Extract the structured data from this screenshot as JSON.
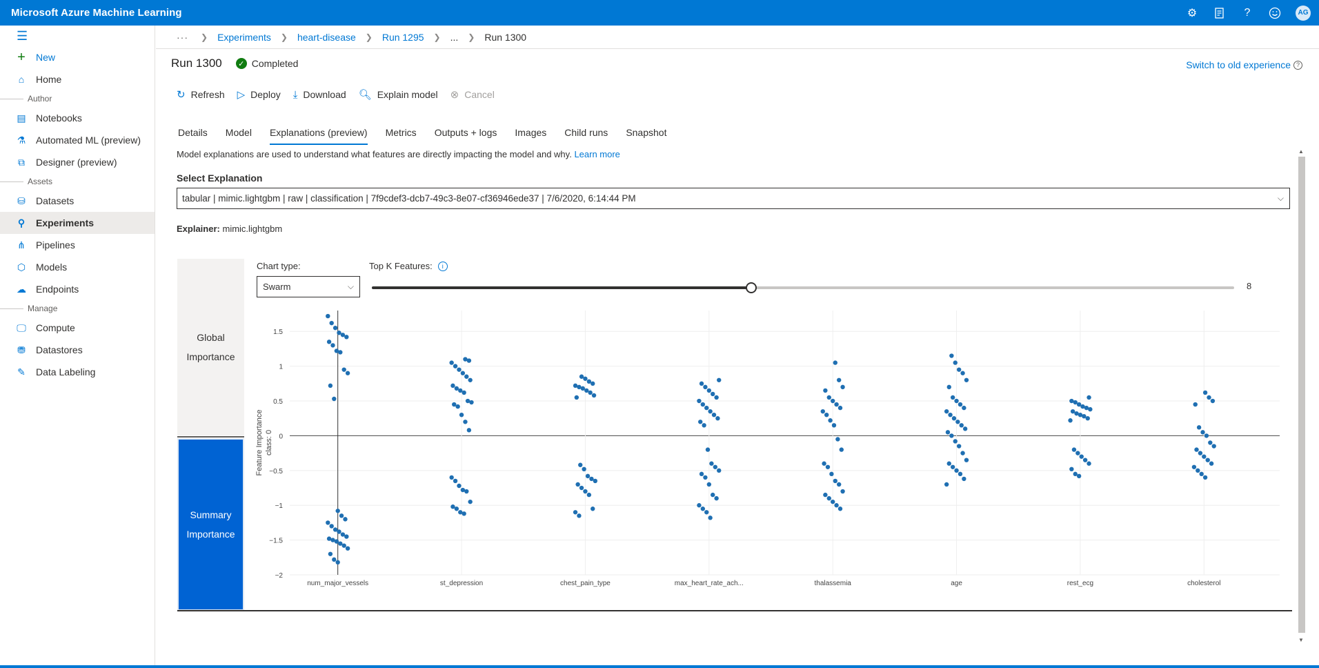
{
  "app": {
    "title": "Microsoft Azure Machine Learning",
    "avatar_initials": "AG",
    "top_icons": [
      "gear-icon",
      "feedback-icon",
      "help-icon",
      "smiley-icon"
    ]
  },
  "sidebar": {
    "new_label": "New",
    "home_label": "Home",
    "groups": {
      "author": "Author",
      "assets": "Assets",
      "manage": "Manage"
    },
    "author_items": [
      "Notebooks",
      "Automated ML (preview)",
      "Designer (preview)"
    ],
    "assets_items": [
      "Datasets",
      "Experiments",
      "Pipelines",
      "Models",
      "Endpoints"
    ],
    "manage_items": [
      "Compute",
      "Datastores",
      "Data Labeling"
    ],
    "active": "Experiments"
  },
  "breadcrumb": {
    "more": "···",
    "items": [
      "Experiments",
      "heart-disease",
      "Run 1295",
      "...",
      "Run 1300"
    ]
  },
  "run": {
    "title": "Run 1300",
    "status": "Completed",
    "switch_link": "Switch to old experience"
  },
  "toolbar": {
    "refresh": "Refresh",
    "deploy": "Deploy",
    "download": "Download",
    "explain": "Explain model",
    "cancel": "Cancel"
  },
  "tabs": [
    "Details",
    "Model",
    "Explanations (preview)",
    "Metrics",
    "Outputs + logs",
    "Images",
    "Child runs",
    "Snapshot"
  ],
  "active_tab": "Explanations (preview)",
  "explanations": {
    "description": "Model explanations are used to understand what features are directly impacting the model and why.",
    "learn_more": "Learn more",
    "select_label": "Select Explanation",
    "select_value": "tabular | mimic.lightgbm | raw | classification | 7f9cdef3-dcb7-49c3-8e07-cf36946ede37 | 7/6/2020, 6:14:44 PM",
    "explainer_label": "Explainer:",
    "explainer_value": "mimic.lightgbm"
  },
  "panel": {
    "global_tab": [
      "Global",
      "Importance"
    ],
    "summary_tab": [
      "Summary",
      "Importance"
    ],
    "chart_type_label": "Chart type:",
    "chart_type_value": "Swarm",
    "topk_label": "Top K Features:",
    "topk_value": "8",
    "topk_fraction": 0.44
  },
  "colors": {
    "accent": "#0078d4",
    "dot": "#1f6fb2",
    "success": "#107c10"
  },
  "chart_data": {
    "type": "scatter",
    "ylabel": "Feature Importance\nclass:  0",
    "ylim": [
      -2,
      1.8
    ],
    "yticks": [
      1.5,
      1,
      0.5,
      0,
      -0.5,
      -1,
      -1.5,
      -2
    ],
    "ytick_labels": [
      "1.5",
      "1",
      "0.5",
      "0",
      "−0.5",
      "−1",
      "−1.5",
      "−2"
    ],
    "categories": [
      "num_major_vessels",
      "st_depression",
      "chest_pain_type",
      "max_heart_rate_ach...",
      "thalassemia",
      "age",
      "rest_ecg",
      "cholesterol"
    ],
    "series": [
      {
        "values": [
          1.72,
          1.62,
          1.55,
          1.48,
          1.45,
          1.42,
          1.35,
          1.3,
          1.22,
          1.2,
          0.95,
          0.9,
          0.72,
          0.53,
          -1.08,
          -1.15,
          -1.2,
          -1.25,
          -1.3,
          -1.35,
          -1.38,
          -1.42,
          -1.45,
          -1.48,
          -1.5,
          -1.52,
          -1.55,
          -1.58,
          -1.62,
          -1.7,
          -1.78,
          -1.82
        ]
      },
      {
        "values": [
          1.1,
          1.08,
          1.05,
          1.0,
          0.95,
          0.9,
          0.85,
          0.8,
          0.72,
          0.68,
          0.65,
          0.62,
          0.5,
          0.48,
          0.45,
          0.42,
          0.3,
          0.2,
          0.08,
          -0.6,
          -0.65,
          -0.72,
          -0.78,
          -0.8,
          -0.95,
          -1.02,
          -1.05,
          -1.1,
          -1.12
        ]
      },
      {
        "values": [
          0.85,
          0.82,
          0.78,
          0.75,
          0.72,
          0.7,
          0.68,
          0.65,
          0.62,
          0.58,
          0.55,
          -0.42,
          -0.48,
          -0.58,
          -0.62,
          -0.65,
          -0.7,
          -0.75,
          -0.8,
          -0.85,
          -1.05,
          -1.1,
          -1.15
        ]
      },
      {
        "values": [
          0.8,
          0.75,
          0.7,
          0.65,
          0.6,
          0.55,
          0.5,
          0.45,
          0.4,
          0.35,
          0.3,
          0.25,
          0.2,
          0.15,
          -0.2,
          -0.4,
          -0.45,
          -0.5,
          -0.55,
          -0.6,
          -0.7,
          -0.85,
          -0.9,
          -1.0,
          -1.05,
          -1.1,
          -1.18
        ]
      },
      {
        "values": [
          1.05,
          0.8,
          0.7,
          0.65,
          0.55,
          0.5,
          0.45,
          0.4,
          0.35,
          0.3,
          0.22,
          0.15,
          -0.05,
          -0.2,
          -0.4,
          -0.45,
          -0.55,
          -0.65,
          -0.7,
          -0.8,
          -0.85,
          -0.9,
          -0.95,
          -1.0,
          -1.05
        ]
      },
      {
        "values": [
          1.15,
          1.05,
          0.95,
          0.9,
          0.8,
          0.7,
          0.55,
          0.5,
          0.45,
          0.4,
          0.35,
          0.3,
          0.25,
          0.2,
          0.15,
          0.1,
          0.05,
          0.0,
          -0.08,
          -0.15,
          -0.25,
          -0.35,
          -0.4,
          -0.45,
          -0.5,
          -0.55,
          -0.62,
          -0.7
        ]
      },
      {
        "values": [
          0.55,
          0.5,
          0.48,
          0.45,
          0.42,
          0.4,
          0.38,
          0.35,
          0.32,
          0.3,
          0.28,
          0.25,
          0.22,
          -0.2,
          -0.25,
          -0.3,
          -0.35,
          -0.4,
          -0.48,
          -0.55,
          -0.58
        ]
      },
      {
        "values": [
          0.62,
          0.55,
          0.5,
          0.45,
          0.12,
          0.05,
          0.0,
          -0.1,
          -0.15,
          -0.2,
          -0.25,
          -0.3,
          -0.35,
          -0.4,
          -0.45,
          -0.5,
          -0.55,
          -0.6
        ]
      }
    ],
    "grid": true
  }
}
